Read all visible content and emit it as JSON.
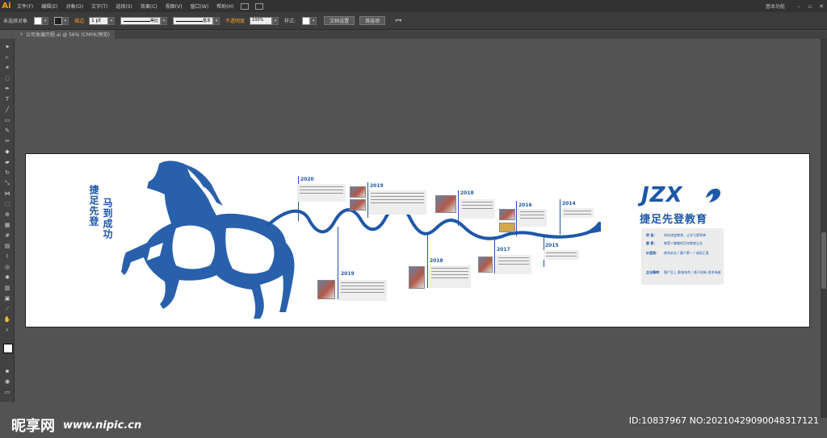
{
  "app": {
    "logo": "Ai",
    "workspace": "基本功能"
  },
  "menu": [
    "文件(F)",
    "编辑(E)",
    "对象(O)",
    "文字(T)",
    "选择(S)",
    "效果(C)",
    "视图(V)",
    "窗口(W)",
    "帮助(H)"
  ],
  "control_bar": {
    "selection": "未选择对象",
    "stroke_label": "描边",
    "stroke_value": "1 pt",
    "profile_1": "等比",
    "profile_2": "基本",
    "opacity_label": "不透明度",
    "opacity_value": "100%",
    "style_label": "样式:",
    "doc_setup": "文档设置",
    "preferences": "首选项"
  },
  "document_tab": {
    "title": "公司发展历程.ai @ 56% (CMYK/预览)",
    "close": "×"
  },
  "artwork": {
    "slogan_1": "捷足先登",
    "slogan_2": "马到成功",
    "years": [
      {
        "label": "2020"
      },
      {
        "label": "2019"
      },
      {
        "label": "2019"
      },
      {
        "label": "2018"
      },
      {
        "label": "2018"
      },
      {
        "label": "2017"
      },
      {
        "label": "2016"
      },
      {
        "label": "2015"
      },
      {
        "label": "2014"
      }
    ],
    "logo": "JZX",
    "company": "捷足先登教育",
    "info": [
      {
        "key": "宗 旨：",
        "value": "科技改变教育，让学习更简单"
      },
      {
        "key": "愿 景：",
        "value": "做受人尊敬的百年教育企业"
      },
      {
        "key": "价值观：",
        "value": "使命必达 / 客户第一 / 诚信正直"
      },
      {
        "key": "企业精神：",
        "value": "客户至上 勤奋协作 / 勇于创新 追求卓越"
      }
    ]
  },
  "watermark": {
    "site": "昵享网",
    "url": "www.nipic.cn",
    "id": "ID:10837967 NO:20210429090048317121"
  }
}
